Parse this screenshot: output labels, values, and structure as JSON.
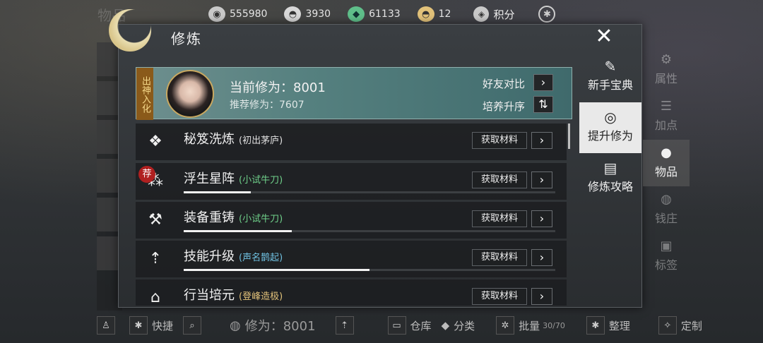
{
  "background": {
    "left_label": "物品"
  },
  "topbar": {
    "resources": [
      {
        "icon": "silver-coin-icon",
        "value": "555980",
        "color": "#c9c9c9"
      },
      {
        "icon": "ingot-icon",
        "value": "3930",
        "color": "#d8d8d8"
      },
      {
        "icon": "green-ticket-icon",
        "value": "61133",
        "color": "#5fbf8a"
      },
      {
        "icon": "gold-ingot-icon",
        "value": "12",
        "color": "#e2c27a"
      }
    ],
    "score_label": "积分"
  },
  "dialog": {
    "title": "修炼",
    "profile": {
      "rank_tag": "出神入化",
      "current_label": "当前修为：8001",
      "recommended_label": "推荐修为：7607",
      "compare_label": "好友对比",
      "sort_label": "培养升序"
    },
    "rows": [
      {
        "name": "秘笈洗炼",
        "sub": "(初出茅庐)",
        "sub_color": "#e0e0e0",
        "button": "获取材料",
        "progress": 0,
        "icon": "scroll-icon",
        "recommended": false
      },
      {
        "name": "浮生星阵",
        "sub": "(小试牛刀)",
        "sub_color": "#6fd08a",
        "button": "获取材料",
        "progress": 0.18,
        "icon": "star-array-icon",
        "recommended": true,
        "badge": "荐"
      },
      {
        "name": "装备重铸",
        "sub": "(小试牛刀)",
        "sub_color": "#6fd08a",
        "button": "获取材料",
        "progress": 0.29,
        "icon": "hammer-icon",
        "recommended": false
      },
      {
        "name": "技能升级",
        "sub": "(声名鹊起)",
        "sub_color": "#6fc0e0",
        "button": "获取材料",
        "progress": 0.5,
        "icon": "skill-up-icon",
        "recommended": false
      },
      {
        "name": "行当培元",
        "sub": "(登峰造极)",
        "sub_color": "#e2c27a",
        "button": "获取材料",
        "progress": 0,
        "icon": "profession-icon",
        "recommended": false
      }
    ],
    "tabs": [
      {
        "label": "新手宝典",
        "icon": "book-icon",
        "active": false
      },
      {
        "label": "提升修为",
        "icon": "spiral-icon",
        "active": true
      },
      {
        "label": "修炼攻略",
        "icon": "scroll-guide-icon",
        "active": false
      }
    ]
  },
  "side_nav": [
    {
      "label": "属性",
      "icon": "attribute-icon",
      "active": false
    },
    {
      "label": "加点",
      "icon": "sliders-icon",
      "active": false
    },
    {
      "label": "物品",
      "icon": "bag-icon",
      "active": true
    },
    {
      "label": "钱庄",
      "icon": "money-icon",
      "active": false
    },
    {
      "label": "标签",
      "icon": "tag-icon",
      "active": false
    }
  ],
  "bottombar": {
    "quick_label": "快捷",
    "cultivation_label": "修为：8001",
    "warehouse_label": "仓库",
    "category_label": "分类",
    "batch_label": "批量",
    "batch_count": "30/70",
    "sort_label": "整理",
    "custom_label": "定制"
  }
}
